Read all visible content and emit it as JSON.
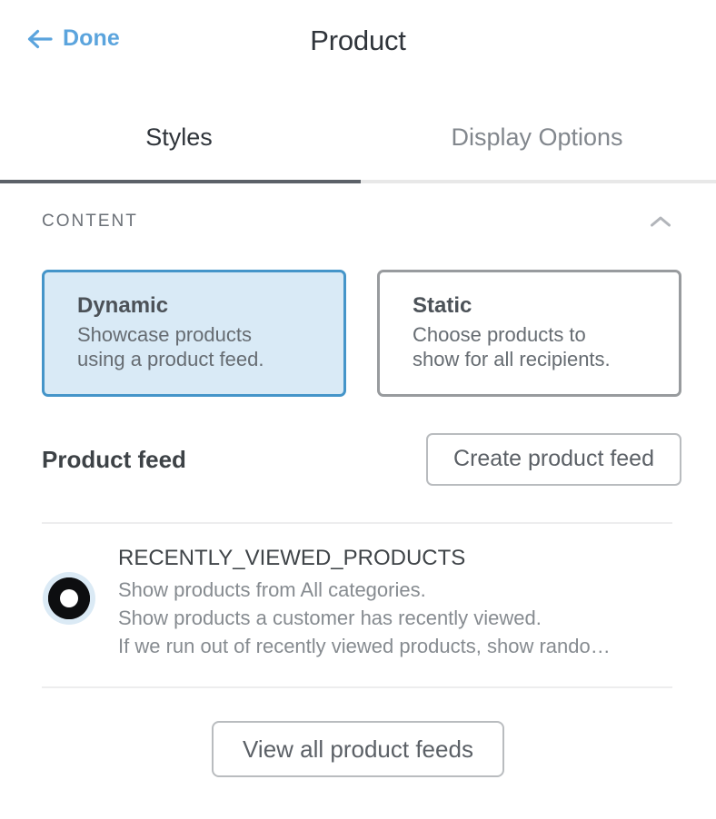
{
  "header": {
    "back_label": "Done",
    "back_icon": "arrow-left-icon",
    "title": "Product",
    "accent_color": "#5ba4dd",
    "title_color": "#30353b"
  },
  "tabs": {
    "items": [
      {
        "label": "Styles",
        "active": true
      },
      {
        "label": "Display Options",
        "active": false
      }
    ],
    "active_underline_color": "#5c6168",
    "track_color": "#e8e8e8"
  },
  "content_section": {
    "title": "CONTENT",
    "collapse_icon": "chevron-up-icon",
    "expanded": true
  },
  "options": [
    {
      "name": "Dynamic",
      "description_lines": [
        "Showcase products",
        "using a product feed."
      ],
      "selected": true,
      "fill": "#d9eaf6",
      "border": "#4595c9"
    },
    {
      "name": "Static",
      "description_lines": [
        "Choose products to",
        "show for all recipients."
      ],
      "selected": false,
      "fill": "#ffffff",
      "border": "#989b9e"
    }
  ],
  "product_feed": {
    "heading": "Product feed",
    "create_button_label": "Create product feed",
    "items": [
      {
        "title": "RECENTLY_VIEWED_PRODUCTS",
        "lines": [
          "Show products from All categories.",
          "Show products a customer has recently viewed.",
          "If we run out of recently viewed products, show rando…"
        ],
        "selected": true,
        "radio_icon": "radio-selected-icon"
      }
    ],
    "view_all_button_label": "View all product feeds"
  }
}
